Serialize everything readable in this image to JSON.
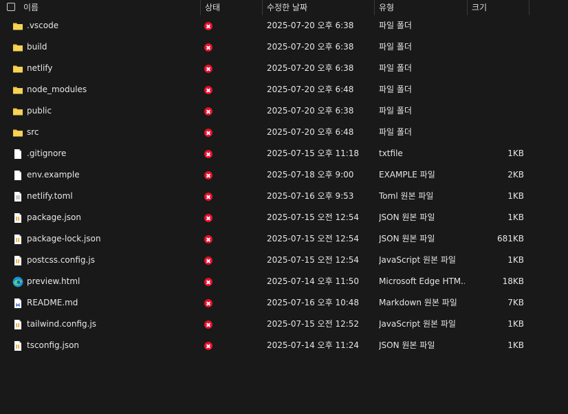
{
  "header": {
    "name": "이름",
    "status": "상태",
    "modified": "수정한 날짜",
    "type": "유형",
    "size": "크기"
  },
  "files": [
    {
      "name": ".vscode",
      "date": "2025-07-20 오후 6:38",
      "type": "파일 폴더",
      "size": "",
      "icon": "folder-icon"
    },
    {
      "name": "build",
      "date": "2025-07-20 오후 6:38",
      "type": "파일 폴더",
      "size": "",
      "icon": "folder-icon"
    },
    {
      "name": "netlify",
      "date": "2025-07-20 오후 6:38",
      "type": "파일 폴더",
      "size": "",
      "icon": "folder-icon"
    },
    {
      "name": "node_modules",
      "date": "2025-07-20 오후 6:48",
      "type": "파일 폴더",
      "size": "",
      "icon": "folder-icon"
    },
    {
      "name": "public",
      "date": "2025-07-20 오후 6:38",
      "type": "파일 폴더",
      "size": "",
      "icon": "folder-icon"
    },
    {
      "name": "src",
      "date": "2025-07-20 오후 6:48",
      "type": "파일 폴더",
      "size": "",
      "icon": "folder-icon"
    },
    {
      "name": ".gitignore",
      "date": "2025-07-15 오후 11:18",
      "type": "txtfile",
      "size": "1KB",
      "icon": "file-icon"
    },
    {
      "name": "env.example",
      "date": "2025-07-18 오후 9:00",
      "type": "EXAMPLE 파일",
      "size": "2KB",
      "icon": "file-icon"
    },
    {
      "name": "netlify.toml",
      "date": "2025-07-16 오후 9:53",
      "type": "Toml 원본 파일",
      "size": "1KB",
      "icon": "text-file-icon"
    },
    {
      "name": "package.json",
      "date": "2025-07-15 오전 12:54",
      "type": "JSON 원본 파일",
      "size": "1KB",
      "icon": "code-file-icon"
    },
    {
      "name": "package-lock.json",
      "date": "2025-07-15 오전 12:54",
      "type": "JSON 원본 파일",
      "size": "681KB",
      "icon": "code-file-icon"
    },
    {
      "name": "postcss.config.js",
      "date": "2025-07-15 오전 12:54",
      "type": "JavaScript 원본 파일",
      "size": "1KB",
      "icon": "code-file-icon"
    },
    {
      "name": "preview.html",
      "date": "2025-07-14 오후 11:50",
      "type": "Microsoft Edge HTM...",
      "size": "18KB",
      "icon": "edge-icon"
    },
    {
      "name": "README.md",
      "date": "2025-07-16 오후 10:48",
      "type": "Markdown 원본 파일",
      "size": "7KB",
      "icon": "markdown-file-icon"
    },
    {
      "name": "tailwind.config.js",
      "date": "2025-07-15 오전 12:52",
      "type": "JavaScript 원본 파일",
      "size": "1KB",
      "icon": "code-file-icon"
    },
    {
      "name": "tsconfig.json",
      "date": "2025-07-14 오후 11:24",
      "type": "JSON 원본 파일",
      "size": "1KB",
      "icon": "code-file-icon"
    }
  ],
  "colors": {
    "background": "#191919",
    "text": "#e6e6e6",
    "sync_error": "#e8112d",
    "folder": "#f3c13a"
  }
}
